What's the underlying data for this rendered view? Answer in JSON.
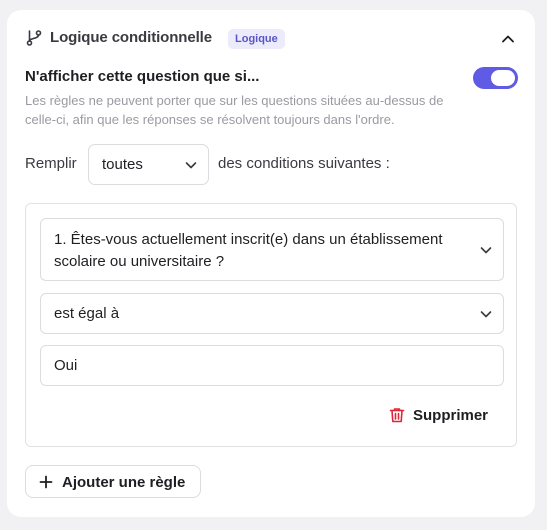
{
  "header": {
    "title": "Logique conditionnelle",
    "badge": "Logique",
    "icon": "git-branch-icon",
    "collapse_icon": "chevron-up-icon"
  },
  "condition": {
    "title": "N'afficher cette question que si...",
    "description": "Les règles ne peuvent porter que sur les questions situées au-dessus de celle-ci, afin que les réponses se résolvent toujours dans l'ordre.",
    "toggle_on": true
  },
  "fill": {
    "prefix": "Remplir",
    "selected": "toutes",
    "suffix": "des conditions suivantes :"
  },
  "rule": {
    "question": "1. Êtes-vous actuellement inscrit(e) dans un établissement scolaire ou universitaire ?",
    "operator": "est égal à",
    "value": "Oui",
    "delete_label": "Supprimer"
  },
  "add_rule_label": "Ajouter une règle",
  "colors": {
    "accent": "#5f5be4",
    "badge_bg": "#ebebfb",
    "badge_text": "#5a55c9",
    "danger": "#e0243a"
  }
}
